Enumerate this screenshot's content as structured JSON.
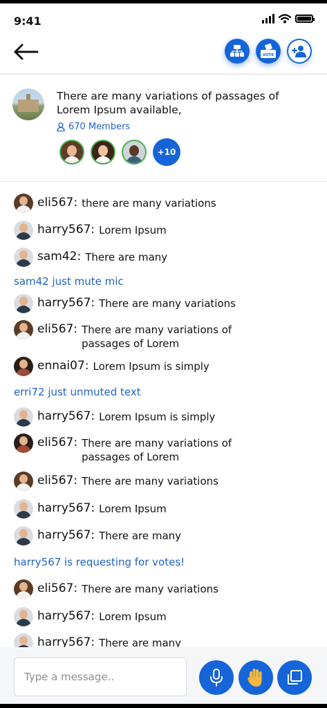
{
  "status_bar": {
    "time": "9:41"
  },
  "header": {
    "back_icon": "arrow-left-icon",
    "buttons": [
      {
        "icon": "group-hierarchy-icon"
      },
      {
        "icon": "vote-box-icon",
        "label": "VOTE"
      },
      {
        "icon": "add-user-icon"
      }
    ]
  },
  "group": {
    "title": "There are many variations of passages of Lorem Ipsum available,",
    "members_count": "670 Members",
    "more_members": "+10"
  },
  "messages": [
    {
      "user": "eli567:",
      "text": "there are many variations"
    },
    {
      "user": "harry567:",
      "text": "Lorem Ipsum"
    },
    {
      "user": "sam42:",
      "text": "There are many"
    },
    {
      "system": "sam42 just mute mic"
    },
    {
      "user": "harry567:",
      "text": "There are many variations"
    },
    {
      "user": "eli567:",
      "text": "There are many variations of passages of Lorem"
    },
    {
      "user": "ennai07:",
      "text": "Lorem Ipsum is simply"
    },
    {
      "system": "erri72 just unmuted text"
    },
    {
      "user": "harry567:",
      "text": "Lorem Ipsum is simply"
    },
    {
      "user": "eli567:",
      "text": "There are many variations of passages of Lorem"
    },
    {
      "user": "eli567:",
      "text": "There are many variations"
    },
    {
      "user": "harry567:",
      "text": "Lorem Ipsum"
    },
    {
      "user": "harry567:",
      "text": "There are many"
    },
    {
      "system": "harry567 is requesting for votes!"
    },
    {
      "user": "eli567:",
      "text": "There are many variations"
    },
    {
      "user": "harry567:",
      "text": "Lorem Ipsum"
    },
    {
      "user": "harry567:",
      "text": "There are many"
    }
  ],
  "composer": {
    "placeholder": "Type a message..",
    "buttons": [
      {
        "icon": "microphone-icon"
      },
      {
        "icon": "raise-hand-icon"
      },
      {
        "icon": "switch-screen-icon"
      }
    ]
  }
}
